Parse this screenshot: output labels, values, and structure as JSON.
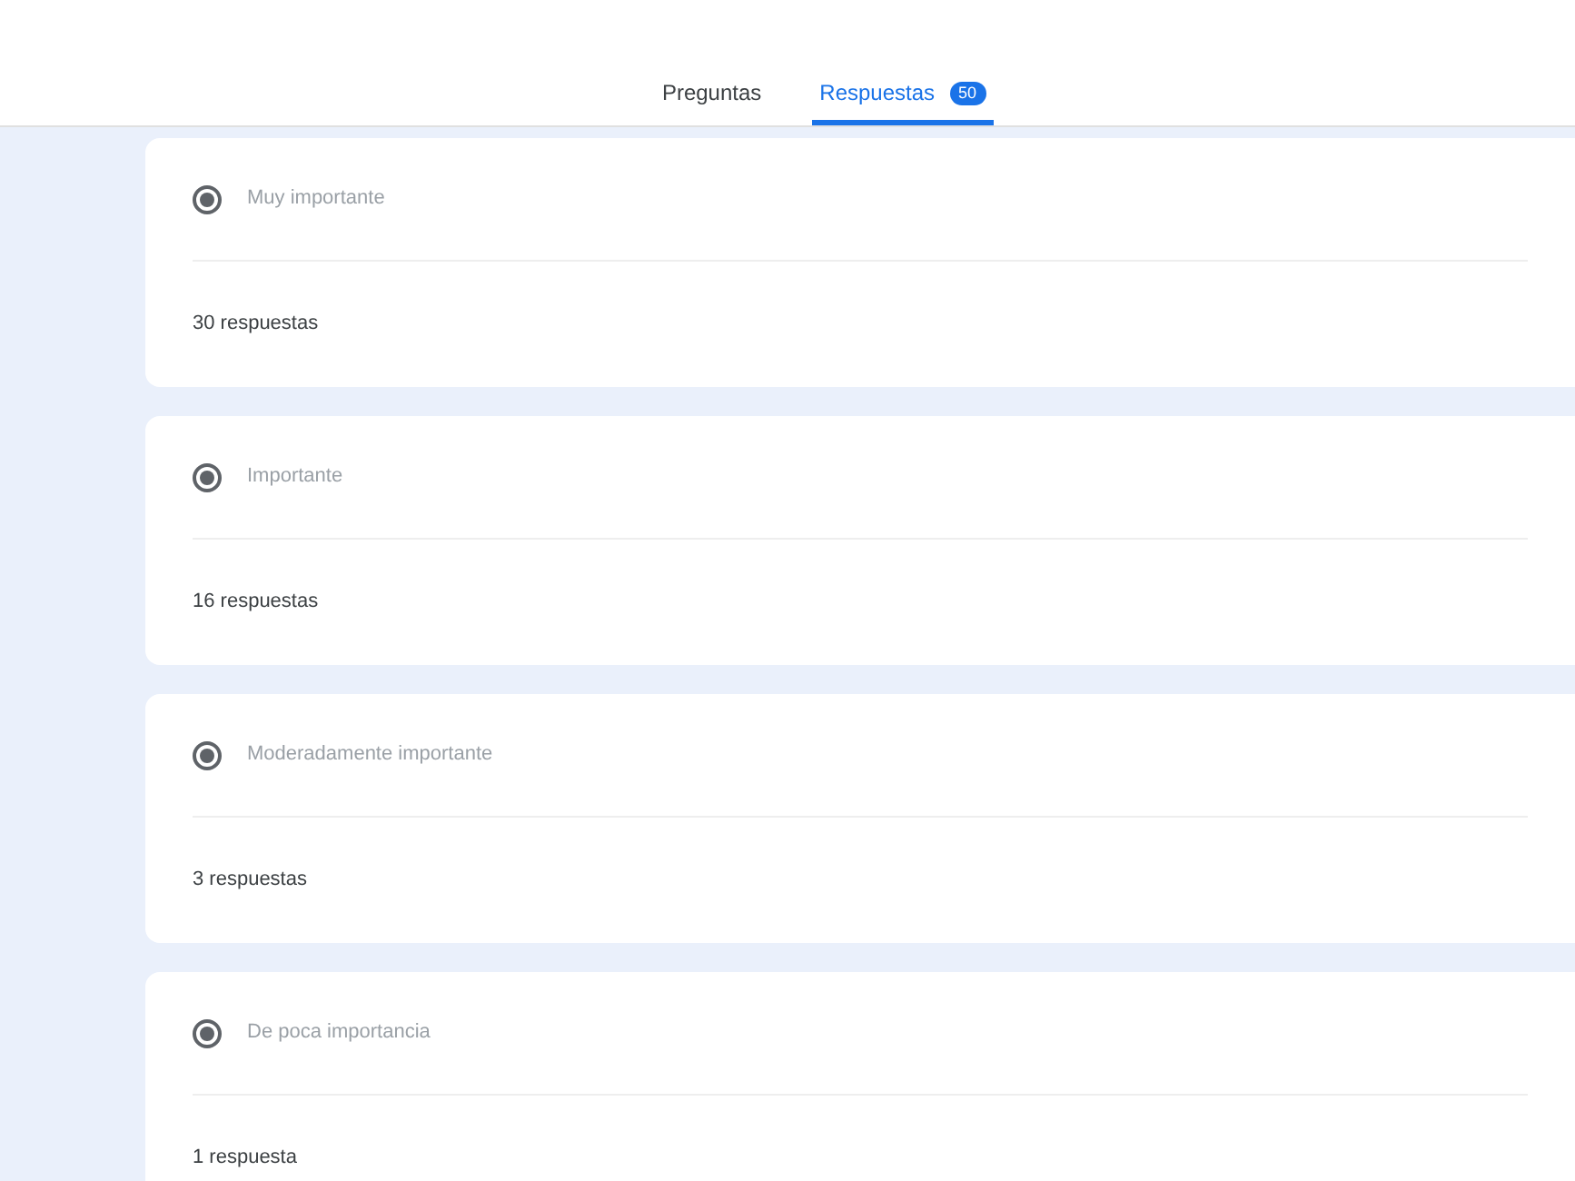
{
  "tabs": [
    {
      "label": "Preguntas",
      "selected": false
    },
    {
      "label": "Respuestas",
      "selected": true,
      "badge": "50"
    }
  ],
  "options": [
    {
      "label": "Muy importante",
      "selected": true,
      "count": "30 respuestas"
    },
    {
      "label": "Importante",
      "selected": true,
      "count": "16 respuestas"
    },
    {
      "label": "Moderadamente importante",
      "selected": true,
      "count": "3 respuestas"
    },
    {
      "label": "De poca importancia",
      "selected": true,
      "count": "1 respuesta"
    }
  ]
}
